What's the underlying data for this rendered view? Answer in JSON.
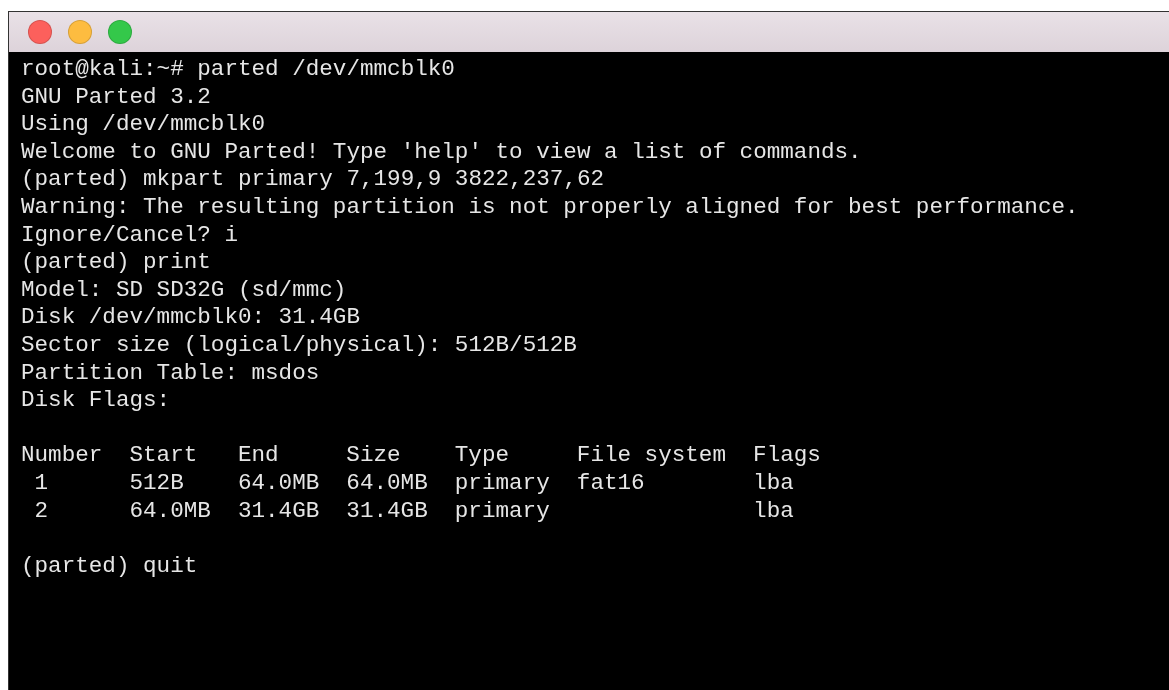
{
  "window": {
    "controls": [
      {
        "kind": "close"
      },
      {
        "kind": "minimize"
      },
      {
        "kind": "maximize"
      }
    ]
  },
  "terminal": {
    "lines": [
      {
        "kind": "text",
        "text": "root@kali:~# parted /dev/mmcblk0"
      },
      {
        "kind": "text",
        "text": "GNU Parted 3.2"
      },
      {
        "kind": "text",
        "text": "Using /dev/mmcblk0"
      },
      {
        "kind": "text",
        "text": "Welcome to GNU Parted! Type 'help' to view a list of commands."
      },
      {
        "kind": "text",
        "text": "(parted) mkpart primary 7,199,9 3822,237,62"
      },
      {
        "kind": "text",
        "text": "Warning: The resulting partition is not properly aligned for best performance."
      },
      {
        "kind": "text",
        "text": "Ignore/Cancel? i"
      },
      {
        "kind": "text",
        "text": "(parted) print"
      },
      {
        "kind": "text",
        "text": "Model: SD SD32G (sd/mmc)"
      },
      {
        "kind": "text",
        "text": "Disk /dev/mmcblk0: 31.4GB"
      },
      {
        "kind": "text",
        "text": "Sector size (logical/physical): 512B/512B"
      },
      {
        "kind": "text",
        "text": "Partition Table: msdos"
      },
      {
        "kind": "text",
        "text": "Disk Flags:"
      },
      {
        "kind": "blank"
      },
      {
        "kind": "table",
        "columns": [
          "Number",
          "Start",
          "End",
          "Size",
          "Type",
          "File system",
          "Flags"
        ],
        "rows": [
          [
            "1",
            "512B",
            "64.0MB",
            "64.0MB",
            "primary",
            "fat16",
            "lba"
          ],
          [
            "2",
            "64.0MB",
            "31.4GB",
            "31.4GB",
            "primary",
            "",
            "lba"
          ]
        ]
      },
      {
        "kind": "blank"
      },
      {
        "kind": "text",
        "text": "(parted) quit"
      }
    ]
  }
}
